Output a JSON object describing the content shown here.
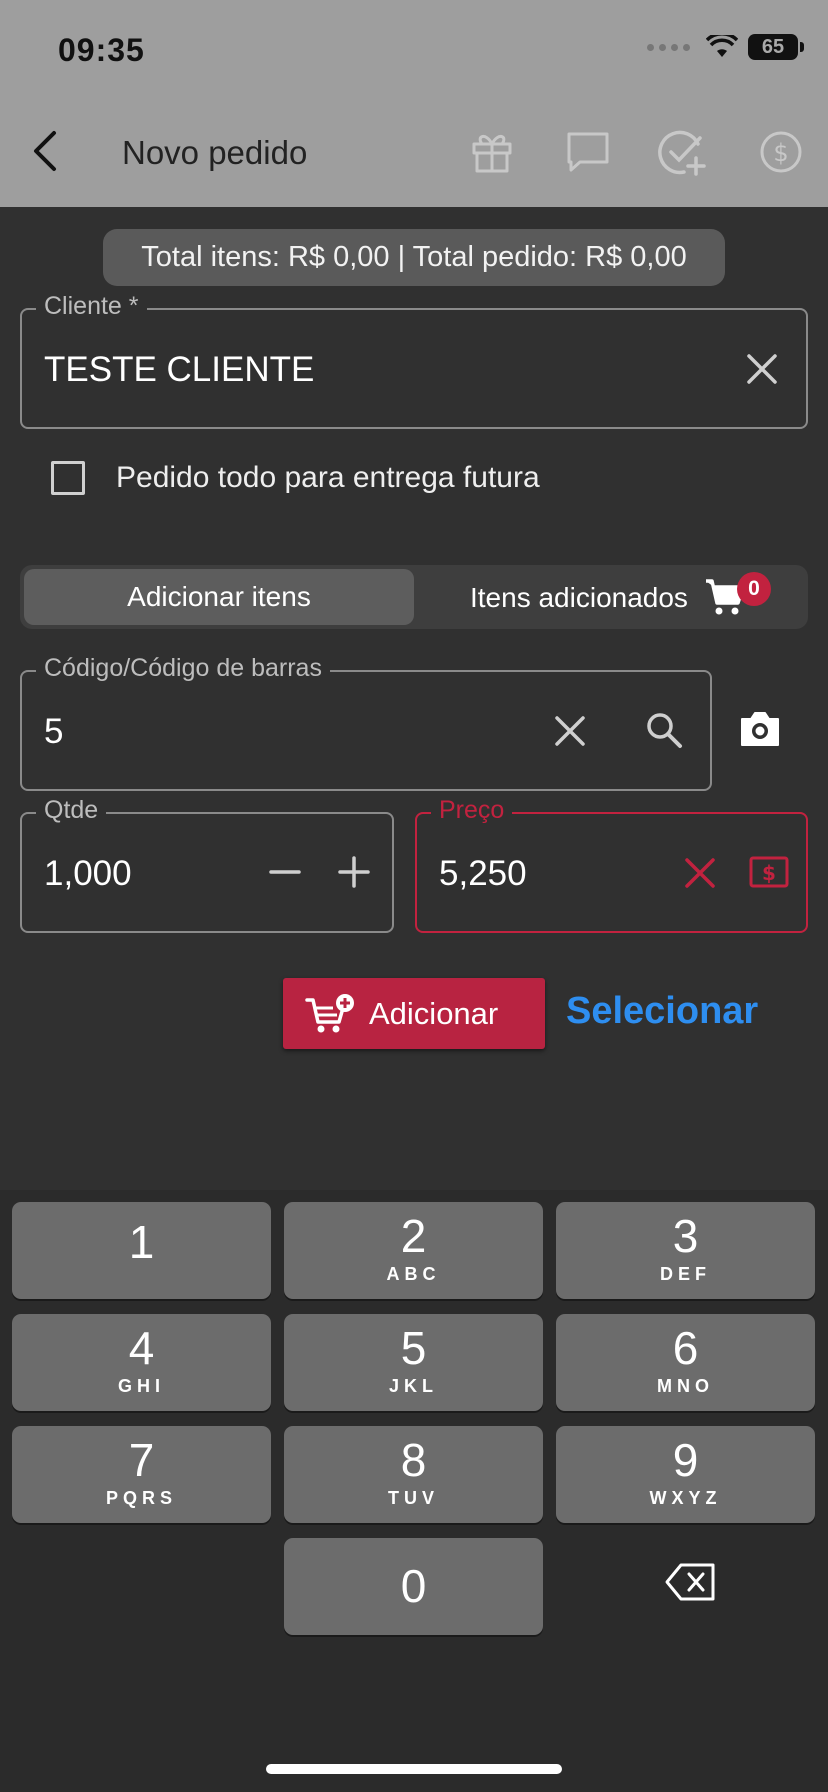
{
  "status_bar": {
    "time": "09:35",
    "battery": "65"
  },
  "app_bar": {
    "title": "Novo pedido",
    "icons": [
      "back-arrow-icon",
      "gift-icon",
      "chat-icon",
      "check-add-icon",
      "dollar-circle-icon"
    ]
  },
  "totals": {
    "text": "Total itens: R$ 0,00 | Total pedido: R$ 0,00"
  },
  "client_field": {
    "label": "Cliente *",
    "value": "TESTE CLIENTE"
  },
  "future_delivery": {
    "label": "Pedido todo para entrega futura",
    "checked": false
  },
  "tabs": {
    "add_items": "Adicionar itens",
    "added_items": "Itens adicionados",
    "cart_count": "0"
  },
  "code_field": {
    "label": "Código/Código de barras",
    "value": "5"
  },
  "qty_field": {
    "label": "Qtde",
    "value": "1,000"
  },
  "price_field": {
    "label": "Preço",
    "value": "5,250"
  },
  "actions": {
    "add_label": "Adicionar",
    "select_label": "Selecionar"
  },
  "keypad": {
    "keys": [
      {
        "num": "1",
        "letters": ""
      },
      {
        "num": "2",
        "letters": "ABC"
      },
      {
        "num": "3",
        "letters": "DEF"
      },
      {
        "num": "4",
        "letters": "GHI"
      },
      {
        "num": "5",
        "letters": "JKL"
      },
      {
        "num": "6",
        "letters": "MNO"
      },
      {
        "num": "7",
        "letters": "PQRS"
      },
      {
        "num": "8",
        "letters": "TUV"
      },
      {
        "num": "9",
        "letters": "WXYZ"
      },
      {
        "num": "0",
        "letters": ""
      }
    ]
  },
  "colors": {
    "accent_red": "#b82341",
    "link_blue": "#2e8ef0",
    "background": "#303030",
    "header": "#9e9e9e"
  }
}
